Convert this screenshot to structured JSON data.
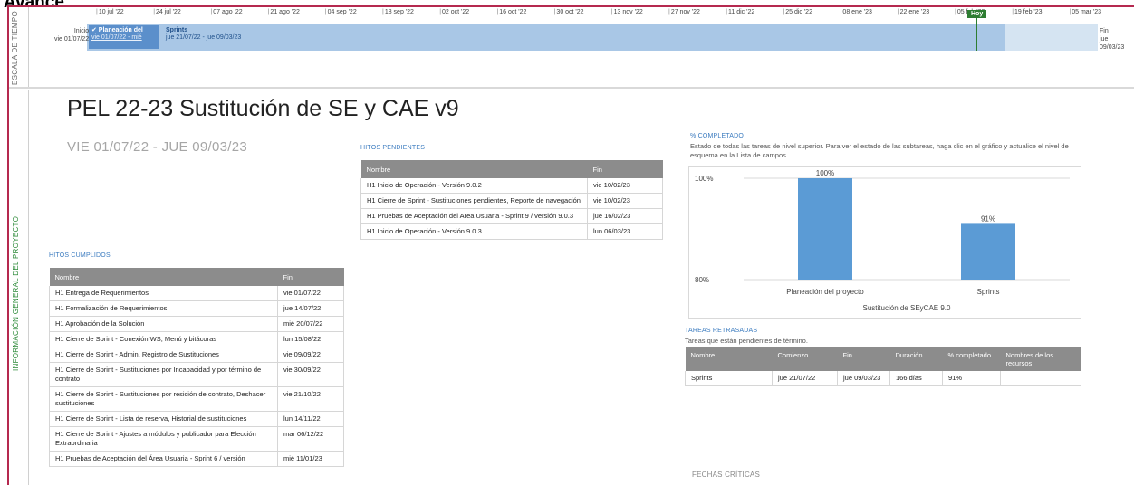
{
  "page_heading": "Avance",
  "timeline": {
    "side_label": "ESCALA DE TIEMPO",
    "ticks": [
      "10 jul '22",
      "24 jul '22",
      "07 ago '22",
      "21 ago '22",
      "04 sep '22",
      "18 sep '22",
      "02 oct '22",
      "16 oct '22",
      "30 oct '22",
      "13 nov '22",
      "27 nov '22",
      "11 dic '22",
      "25 dic '22",
      "08 ene '23",
      "22 ene '23",
      "05 feb '23",
      "19 feb '23",
      "05 mar '23"
    ],
    "start_label": "Inicio",
    "start_date": "vie 01/07/22",
    "end_label": "Fin",
    "end_date": "jue 09/03/23",
    "today_label": "Hoy",
    "task1_name": "✔ Planeación del",
    "task1_dates": "vie 01/07/22 - mié",
    "task2_name": "Sprints",
    "task2_dates": "jue 21/07/22 - jue 09/03/23",
    "colors": {
      "bar_light": "#d5e4f2",
      "bar_mid": "#a9c7e6",
      "bar_dark": "#5b8fcb",
      "today": "#2e7d32"
    }
  },
  "sidebar_label": "INFORMACIÓN GENERAL DEL PROYECTO",
  "report": {
    "title": "PEL 22-23 Sustitución de SE y CAE v9",
    "dates": "VIE 01/07/22   - JUE 09/03/23"
  },
  "hitos_pendientes": {
    "title": "HITOS PENDIENTES",
    "headers": [
      "Nombre",
      "Fin"
    ],
    "rows": [
      [
        "H1 Inicio de Operación - Versión 9.0.2",
        "vie 10/02/23"
      ],
      [
        "H1 Cierre de Sprint - Sustituciones pendientes, Reporte de navegación",
        "vie 10/02/23"
      ],
      [
        "H1 Pruebas de Aceptación del Area Usuaria - Sprint 9 / versión 9.0.3",
        "jue 16/02/23"
      ],
      [
        "H1 Inicio de Operación - Versión 9.0.3",
        "lun 06/03/23"
      ]
    ]
  },
  "hitos_cumplidos": {
    "title": "HITOS CUMPLIDOS",
    "headers": [
      "Nombre",
      "Fin"
    ],
    "rows": [
      [
        "H1 Entrega de Requerimientos",
        "vie 01/07/22"
      ],
      [
        "H1 Formalización de Requerimientos",
        "jue 14/07/22"
      ],
      [
        "H1 Aprobación de la Solución",
        "mié 20/07/22"
      ],
      [
        "H1 Cierre de Sprint - Conexión WS, Menú y bitácoras",
        "lun 15/08/22"
      ],
      [
        "H1 Cierre de Sprint - Admin, Registro de Sustituciones",
        "vie 09/09/22"
      ],
      [
        "H1 Cierre de Sprint - Sustituciones por Incapacidad y por término de contrato",
        "vie 30/09/22"
      ],
      [
        "H1 Cierre de Sprint - Sustituciones por resición de contrato, Deshacer sustituciones",
        "vie 21/10/22"
      ],
      [
        "H1 Cierre de Sprint - Lista de reserva, Historial de sustituciones",
        "lun 14/11/22"
      ],
      [
        "H1 Cierre de Sprint - Ajustes a módulos y publicador para Elección Extraordinaria",
        "mar 06/12/22"
      ],
      [
        "H1 Pruebas de Aceptación del Área Usuaria - Sprint 6 / versión",
        "mié 11/01/23"
      ]
    ]
  },
  "completado": {
    "title": "% COMPLETADO",
    "subtitle": "Estado de todas las tareas de nivel superior. Para ver el estado de las subtareas, haga clic en el gráfico y actualice el nivel de esquema en la Lista de campos."
  },
  "chart_data": {
    "type": "bar",
    "categories": [
      "Planeación del proyecto",
      "Sprints"
    ],
    "values": [
      100,
      91
    ],
    "data_labels": [
      "100%",
      "91%"
    ],
    "xlabel": "Sustitución de SEyCAE 9.0",
    "ylim": [
      80,
      100
    ],
    "y_ticks": [
      "100%",
      "80%"
    ],
    "bar_color": "#5b9bd5",
    "grid": true
  },
  "tareas_retrasadas": {
    "title": "TAREAS RETRASADAS",
    "subtitle": "Tareas que están pendientes de término.",
    "headers": [
      "Nombre",
      "Comienzo",
      "Fin",
      "Duración",
      "% completado",
      "Nombres de los recursos"
    ],
    "rows": [
      [
        "Sprints",
        "jue 21/07/22",
        "jue 09/03/23",
        "166 días",
        "91%",
        ""
      ]
    ]
  },
  "fechas_criticas": {
    "title": "FECHAS CRÍTICAS"
  }
}
